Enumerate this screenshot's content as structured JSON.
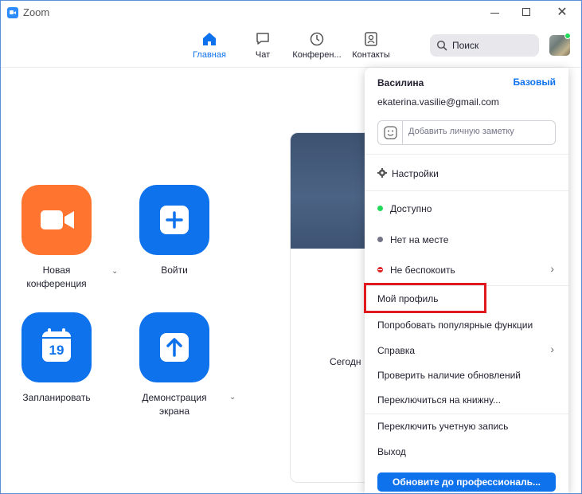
{
  "window": {
    "title": "Zoom"
  },
  "nav": {
    "home": "Главная",
    "chat": "Чат",
    "meetings": "Конферен...",
    "contacts": "Контакты",
    "search": "Поиск"
  },
  "actions": {
    "new_meeting": "Новая конференция",
    "join": "Войти",
    "schedule": "Запланировать",
    "share_screen": "Демонстрация экрана",
    "calendar_day": "19"
  },
  "card": {
    "today_text": "Сегодн"
  },
  "menu": {
    "user_name": "Василина",
    "plan": "Базовый",
    "email": "ekaterina.vasilie@gmail.com",
    "note_placeholder": "Добавить личную заметку",
    "settings": "Настройки",
    "available": "Доступно",
    "away": "Нет на месте",
    "dnd": "Не беспокоить",
    "my_profile": "Мой профиль",
    "try_features": "Попробовать популярные функции",
    "help": "Справка",
    "check_updates": "Проверить наличие обновлений",
    "switch_portrait": "Переключиться на книжну...",
    "switch_account": "Переключить учетную запись",
    "logout": "Выход",
    "upgrade": "Обновите до профессиональ..."
  },
  "colors": {
    "accent": "#0e72ed",
    "orange": "#ff742e",
    "available": "#23d959",
    "dnd": "#e02828",
    "highlight": "#e0191f"
  }
}
